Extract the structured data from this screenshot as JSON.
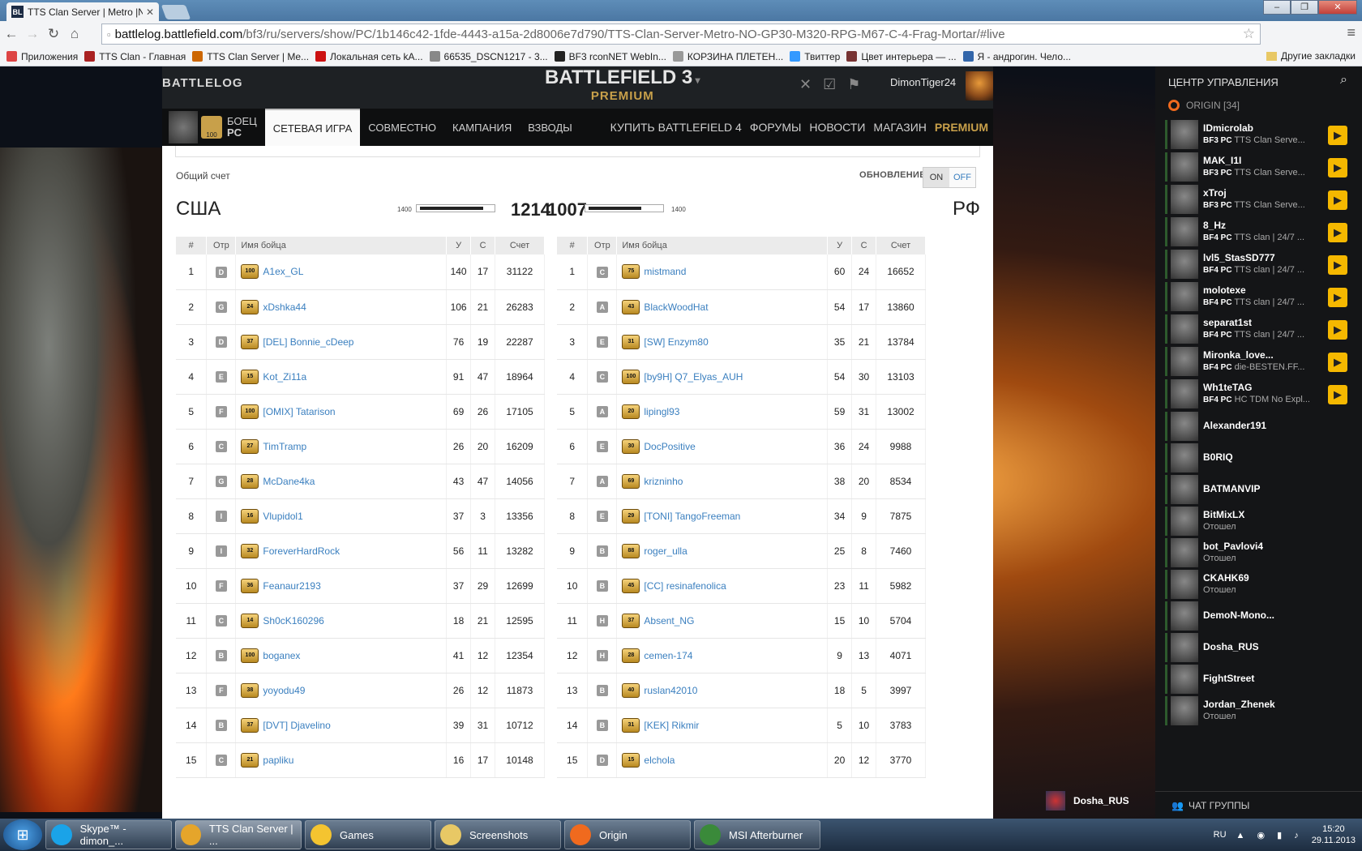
{
  "browser": {
    "tab_title": "TTS Clan Server | Metro |N",
    "tab_icon_text": "BL",
    "url_host": "battlelog.battlefield.com",
    "url_path": "/bf3/ru/servers/show/PC/1b146c42-1fde-4443-a15a-2d8006e7d790/TTS-Clan-Server-Metro-NO-GP30-M320-RPG-M67-C-4-Frag-Mortar/#live",
    "bookmarks": [
      {
        "label": "Приложения",
        "color": "#d44"
      },
      {
        "label": "TTS Clan - Главная",
        "color": "#a22"
      },
      {
        "label": "TTS Clan Server | Me...",
        "color": "#c60"
      },
      {
        "label": "Локальная сеть kA...",
        "color": "#c11"
      },
      {
        "label": "66535_DSCN1217 - 3...",
        "color": "#888"
      },
      {
        "label": "BF3 rconNET WebIn...",
        "color": "#222"
      },
      {
        "label": "КОРЗИНА ПЛЕТЕН...",
        "color": "#999"
      },
      {
        "label": "Твиттер",
        "color": "#39f"
      },
      {
        "label": "Цвет интерьера — ...",
        "color": "#733"
      },
      {
        "label": "Я - андрогин. Чело...",
        "color": "#36a"
      }
    ],
    "other_bookmarks": "Другие закладки"
  },
  "battlelog": {
    "logo": "BATTLELOG",
    "game_title": "BATTLEFIELD 3",
    "game_sub": "PREMIUM",
    "username": "DimonTiger24",
    "soldier_label": "БОЕЦ",
    "soldier_platform": "PC",
    "soldier_rank": "100",
    "nav": [
      "СЕТЕВАЯ ИГРА",
      "СОВМЕСТНО",
      "КАМПАНИЯ",
      "ВЗВОДЫ"
    ],
    "nav_right": [
      "КУПИТЬ BATTLEFIELD 4",
      "ФОРУМЫ",
      "НОВОСТИ",
      "МАГАЗИН"
    ],
    "premium_link": "PREMIUM"
  },
  "scoreboard": {
    "total_label": "Общий счет",
    "update_label": "ОБНОВЛЕНИЕ",
    "on": "ON",
    "off": "OFF",
    "team_left": "США",
    "team_right": "РФ",
    "score_left": "1214",
    "score_right": "1007",
    "ticket_cap_left": "1400",
    "ticket_cap_right": "1400",
    "fill_left": 0.867,
    "fill_right": 0.719,
    "headers": [
      "#",
      "Отр",
      "Имя бойца",
      "У",
      "С",
      "Счет"
    ],
    "left_rows": [
      [
        "1",
        "D",
        "100",
        "A1ex_GL",
        "140",
        "17",
        "31122"
      ],
      [
        "2",
        "G",
        "24",
        "xDshka44",
        "106",
        "21",
        "26283"
      ],
      [
        "3",
        "D",
        "37",
        "[DEL] Bonnie_cDeep",
        "76",
        "19",
        "22287"
      ],
      [
        "4",
        "E",
        "15",
        "Kot_Zi11a",
        "91",
        "47",
        "18964"
      ],
      [
        "5",
        "F",
        "100",
        "[OMIX] Tatarison",
        "69",
        "26",
        "17105"
      ],
      [
        "6",
        "C",
        "27",
        "TimTramp",
        "26",
        "20",
        "16209"
      ],
      [
        "7",
        "G",
        "28",
        "McDane4ka",
        "43",
        "47",
        "14056"
      ],
      [
        "8",
        "I",
        "16",
        "Vlupidol1",
        "37",
        "3",
        "13356"
      ],
      [
        "9",
        "I",
        "32",
        "ForeverHardRock",
        "56",
        "11",
        "13282"
      ],
      [
        "10",
        "F",
        "36",
        "Feanaur2193",
        "37",
        "29",
        "12699"
      ],
      [
        "11",
        "C",
        "14",
        "Sh0cK160296",
        "18",
        "21",
        "12595"
      ],
      [
        "12",
        "B",
        "100",
        "boganex",
        "41",
        "12",
        "12354"
      ],
      [
        "13",
        "F",
        "38",
        "yoyodu49",
        "26",
        "12",
        "11873"
      ],
      [
        "14",
        "B",
        "37",
        "[DVT] Djavelino",
        "39",
        "31",
        "10712"
      ],
      [
        "15",
        "C",
        "21",
        "papliku",
        "16",
        "17",
        "10148"
      ]
    ],
    "right_rows": [
      [
        "1",
        "C",
        "75",
        "mistmand",
        "60",
        "24",
        "16652"
      ],
      [
        "2",
        "A",
        "43",
        "BlackWoodHat",
        "54",
        "17",
        "13860"
      ],
      [
        "3",
        "E",
        "31",
        "[SW] Enzym80",
        "35",
        "21",
        "13784"
      ],
      [
        "4",
        "C",
        "100",
        "[by9H] Q7_Elyas_AUH",
        "54",
        "30",
        "13103"
      ],
      [
        "5",
        "A",
        "20",
        "lipingl93",
        "59",
        "31",
        "13002"
      ],
      [
        "6",
        "E",
        "30",
        "DocPositive",
        "36",
        "24",
        "9988"
      ],
      [
        "7",
        "A",
        "69",
        "krizninho",
        "38",
        "20",
        "8534"
      ],
      [
        "8",
        "E",
        "29",
        "[TONI] TangoFreeman",
        "34",
        "9",
        "7875"
      ],
      [
        "9",
        "B",
        "88",
        "roger_ulla",
        "25",
        "8",
        "7460"
      ],
      [
        "10",
        "B",
        "45",
        "[CC] resinafenolica",
        "23",
        "11",
        "5982"
      ],
      [
        "11",
        "H",
        "37",
        "Absent_NG",
        "15",
        "10",
        "5704"
      ],
      [
        "12",
        "H",
        "28",
        "cemen-174",
        "9",
        "13",
        "4071"
      ],
      [
        "13",
        "B",
        "40",
        "ruslan42010",
        "18",
        "5",
        "3997"
      ],
      [
        "14",
        "B",
        "31",
        "[KEK] Rikmir",
        "5",
        "10",
        "3783"
      ],
      [
        "15",
        "D",
        "15",
        "elchola",
        "20",
        "12",
        "3770"
      ]
    ]
  },
  "origin": {
    "header": "ЦЕНТР УПРАВЛЕНИЯ",
    "group": "ORIGIN [34]",
    "friends": [
      {
        "name": "IDmicrolab",
        "game": "BF3 PC",
        "status": "TTS Clan Serve...",
        "play": true
      },
      {
        "name": "MAK_I1I",
        "game": "BF3 PC",
        "status": "TTS Clan Serve...",
        "play": true
      },
      {
        "name": "xTroj",
        "game": "BF3 PC",
        "status": "TTS Clan Serve...",
        "play": true
      },
      {
        "name": "8_Hz",
        "game": "BF4 PC",
        "status": "TTS clan | 24/7 ...",
        "play": true
      },
      {
        "name": "lvl5_StasSD777",
        "game": "BF4 PC",
        "status": "TTS clan | 24/7 ...",
        "play": true
      },
      {
        "name": "molotexe",
        "game": "BF4 PC",
        "status": "TTS clan | 24/7 ...",
        "play": true
      },
      {
        "name": "separat1st",
        "game": "BF4 PC",
        "status": "TTS clan | 24/7 ...",
        "play": true
      },
      {
        "name": "Mironka_love...",
        "game": "BF4 PC",
        "status": "die-BESTEN.FF...",
        "play": true
      },
      {
        "name": "Wh1teTAG",
        "game": "BF4 PC",
        "status": "HC TDM No Expl...",
        "play": true
      },
      {
        "name": "Alexander191",
        "game": "",
        "status": "",
        "play": false
      },
      {
        "name": "B0RIQ",
        "game": "",
        "status": "",
        "play": false
      },
      {
        "name": "BATMANVIP",
        "game": "",
        "status": "",
        "play": false
      },
      {
        "name": "BitMixLX",
        "game": "",
        "status": "Отошел",
        "play": false
      },
      {
        "name": "bot_Pavlovi4",
        "game": "",
        "status": "Отошел",
        "play": false
      },
      {
        "name": "CKAHK69",
        "game": "",
        "status": "Отошел",
        "play": false
      },
      {
        "name": "DemoN-Mono...",
        "game": "",
        "status": "",
        "play": false
      },
      {
        "name": "Dosha_RUS",
        "game": "",
        "status": "",
        "play": false
      },
      {
        "name": "FightStreet",
        "game": "",
        "status": "",
        "play": false
      },
      {
        "name": "Jordan_Zhenek",
        "game": "",
        "status": "Отошел",
        "play": false
      }
    ],
    "chat_popup": "Dosha_RUS",
    "footer": "ЧАТ ГРУППЫ"
  },
  "taskbar": {
    "items": [
      {
        "label": "Skype™ - dimon_...",
        "color": "#1aa3e8"
      },
      {
        "label": "TTS Clan Server | ...",
        "color": "#e5a52b"
      },
      {
        "label": "Games",
        "color": "#f4c430"
      },
      {
        "label": "Screenshots",
        "color": "#e8c865"
      },
      {
        "label": "Origin",
        "color": "#f06a1e"
      },
      {
        "label": "MSI Afterburner",
        "color": "#3a8a3a"
      }
    ],
    "lang": "RU",
    "time": "15:20",
    "date": "29.11.2013"
  }
}
